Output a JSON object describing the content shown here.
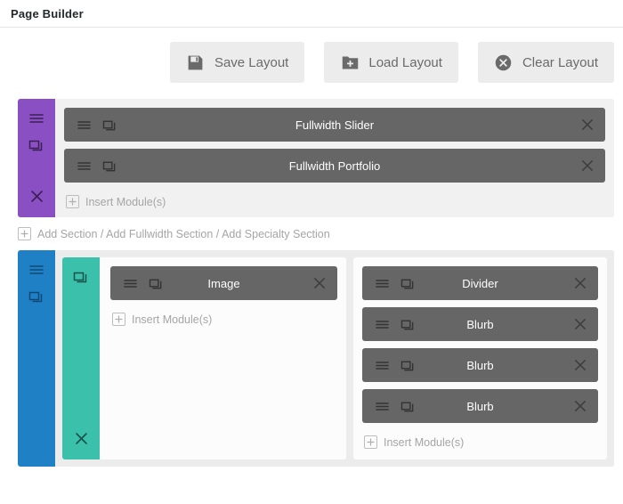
{
  "header": {
    "title": "Page Builder"
  },
  "toolbar": {
    "buttons": [
      {
        "label": "Save Layout",
        "icon": "floppy-disk-icon"
      },
      {
        "label": "Load Layout",
        "icon": "folder-plus-icon"
      },
      {
        "label": "Clear Layout",
        "icon": "circle-x-icon"
      }
    ]
  },
  "colors": {
    "section_fullwidth": "#8b4fc4",
    "section_specialty": "#2080c6",
    "column": "#3bc1ab",
    "module": "#666666",
    "section_body": "#f1f1f1",
    "toolbar_button": "#ececec"
  },
  "sections": [
    {
      "type": "fullwidth",
      "accent": "#8b4fc4",
      "sidebar_icons": [
        "settings-hamburger-icon",
        "duplicate-icon",
        "close-x-icon"
      ],
      "modules": [
        {
          "title": "Fullwidth Slider"
        },
        {
          "title": "Fullwidth Portfolio"
        }
      ],
      "insert_label": "Insert Module(s)"
    },
    {
      "type": "specialty",
      "accent": "#2080c6",
      "sidebar_icons": [
        "settings-hamburger-icon",
        "duplicate-icon"
      ],
      "columns": [
        {
          "accent": "#3bc1ab",
          "sidebar_icons": [
            "duplicate-icon",
            "close-x-icon"
          ],
          "modules": [
            {
              "title": "Image"
            }
          ],
          "insert_label": "Insert Module(s)"
        },
        {
          "modules": [
            {
              "title": "Divider"
            },
            {
              "title": "Blurb"
            },
            {
              "title": "Blurb"
            },
            {
              "title": "Blurb"
            }
          ],
          "insert_label": "Insert Module(s)"
        }
      ]
    }
  ],
  "add_section": {
    "label": "Add Section / Add Fullwidth Section / Add Specialty Section"
  }
}
